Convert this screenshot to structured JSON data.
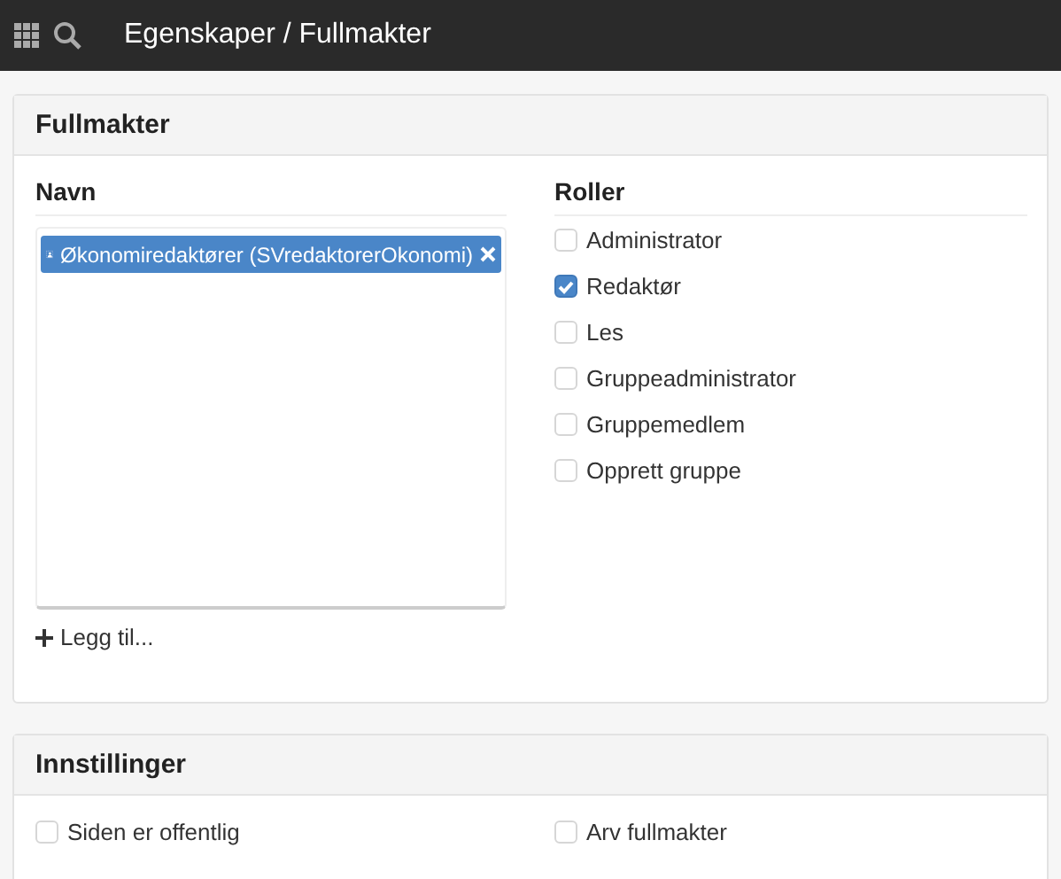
{
  "topbar": {
    "title": "Egenskaper / Fullmakter"
  },
  "permissions": {
    "title": "Fullmakter",
    "names": {
      "heading": "Navn",
      "items": [
        {
          "label": "Økonomiredaktører (SVredaktorerOkonomi)",
          "selected": true
        }
      ],
      "add_label": "Legg til..."
    },
    "roles": {
      "heading": "Roller",
      "items": [
        {
          "label": "Administrator",
          "checked": false
        },
        {
          "label": "Redaktør",
          "checked": true
        },
        {
          "label": "Les",
          "checked": false
        },
        {
          "label": "Gruppeadministrator",
          "checked": false
        },
        {
          "label": "Gruppemedlem",
          "checked": false
        },
        {
          "label": "Opprett gruppe",
          "checked": false
        }
      ]
    }
  },
  "settings": {
    "title": "Innstillinger",
    "items": [
      {
        "label": "Siden er offentlig",
        "checked": false
      },
      {
        "label": "Arv fullmakter",
        "checked": false
      }
    ]
  }
}
